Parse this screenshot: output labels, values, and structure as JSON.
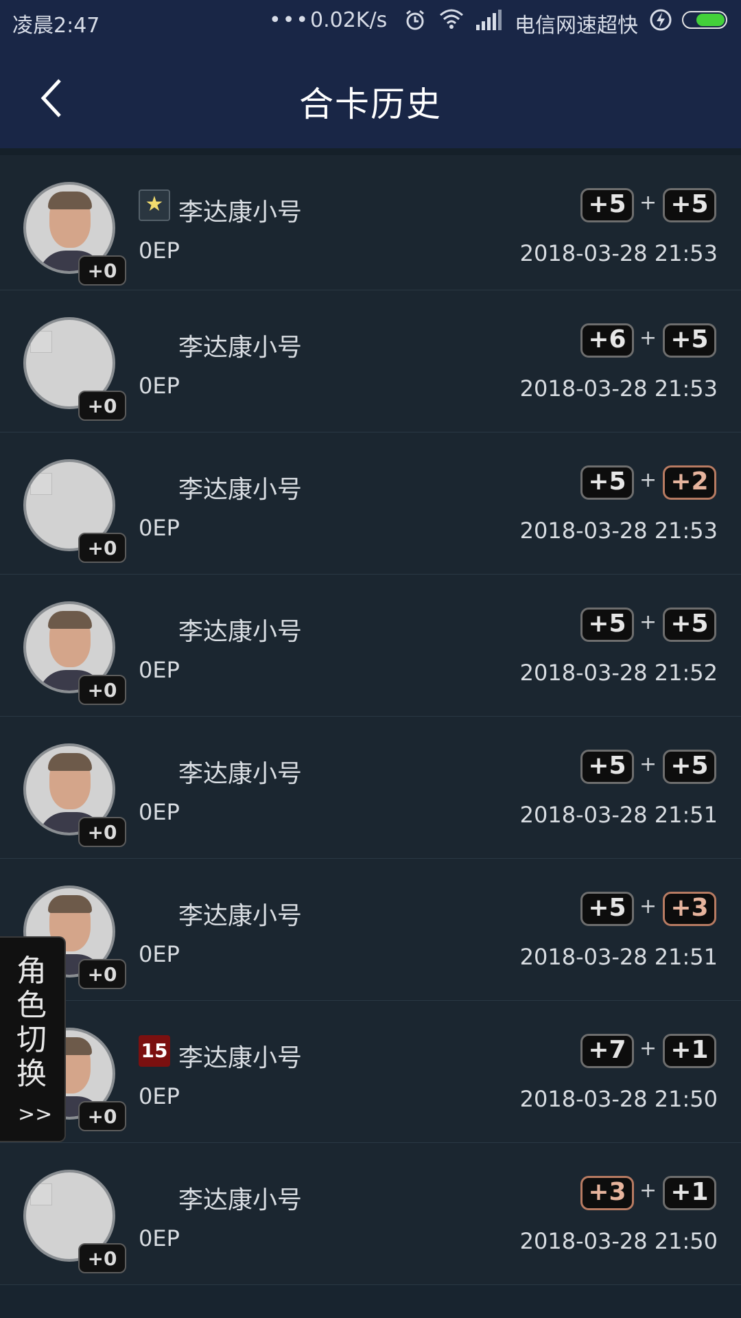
{
  "status_bar": {
    "time": "凌晨2:47",
    "dots": "•••",
    "net_speed": "0.02K/s",
    "alarm_icon": "alarm-clock-icon",
    "wifi_icon": "wifi-icon",
    "signal_icon": "signal-icon",
    "carrier": "电信网速超快",
    "charging_icon": "charging-icon",
    "battery_level": 0.7
  },
  "header": {
    "title": "合卡历史",
    "back_icon": "chevron-left-icon"
  },
  "rows": [
    {
      "avatar": "photo",
      "level": "+0",
      "badge": "star",
      "name": "李达康小号",
      "ep": "0EP",
      "left": "+5",
      "left_tone": "silver",
      "plus": "+",
      "right": "+5",
      "right_tone": "silver",
      "time": "2018-03-28 21:53"
    },
    {
      "avatar": "empty",
      "level": "+0",
      "badge": "",
      "name": "李达康小号",
      "ep": "0EP",
      "left": "+6",
      "left_tone": "silver",
      "plus": "+",
      "right": "+5",
      "right_tone": "silver",
      "time": "2018-03-28 21:53"
    },
    {
      "avatar": "empty",
      "level": "+0",
      "badge": "",
      "name": "李达康小号",
      "ep": "0EP",
      "left": "+5",
      "left_tone": "silver",
      "plus": "+",
      "right": "+2",
      "right_tone": "bronze",
      "time": "2018-03-28 21:53"
    },
    {
      "avatar": "photo",
      "level": "+0",
      "badge": "",
      "name": "李达康小号",
      "ep": "0EP",
      "left": "+5",
      "left_tone": "silver",
      "plus": "+",
      "right": "+5",
      "right_tone": "silver",
      "time": "2018-03-28 21:52"
    },
    {
      "avatar": "photo",
      "level": "+0",
      "badge": "",
      "name": "李达康小号",
      "ep": "0EP",
      "left": "+5",
      "left_tone": "silver",
      "plus": "+",
      "right": "+5",
      "right_tone": "silver",
      "time": "2018-03-28 21:51"
    },
    {
      "avatar": "photo",
      "level": "+0",
      "badge": "",
      "name": "李达康小号",
      "ep": "0EP",
      "left": "+5",
      "left_tone": "silver",
      "plus": "+",
      "right": "+3",
      "right_tone": "bronze",
      "time": "2018-03-28 21:51"
    },
    {
      "avatar": "photo",
      "level": "+0",
      "badge": "15",
      "name": "李达康小号",
      "ep": "0EP",
      "left": "+7",
      "left_tone": "silver",
      "plus": "+",
      "right": "+1",
      "right_tone": "silver",
      "time": "2018-03-28 21:50"
    },
    {
      "avatar": "empty",
      "level": "+0",
      "badge": "",
      "name": "李达康小号",
      "ep": "0EP",
      "left": "+3",
      "left_tone": "bronze",
      "plus": "+",
      "right": "+1",
      "right_tone": "silver",
      "time": "2018-03-28 21:50"
    }
  ],
  "side_tab": {
    "label": "角色切换",
    "arrow": ">>"
  }
}
